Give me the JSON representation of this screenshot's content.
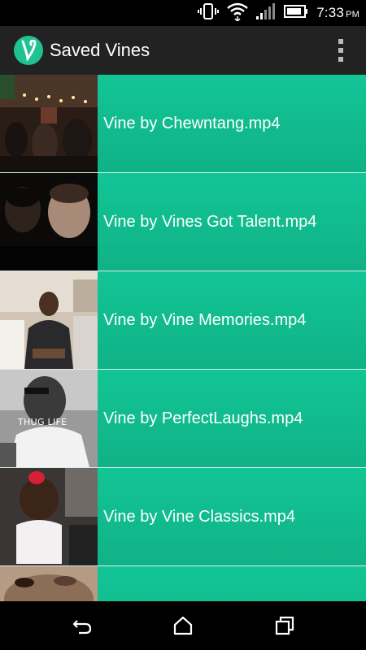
{
  "status_bar": {
    "time": "7:33",
    "ampm": "PM"
  },
  "action_bar": {
    "title": "Saved Vines"
  },
  "vines": [
    {
      "label": "Vine by Chewntang.mp4"
    },
    {
      "label": "Vine by Vines Got Talent.mp4"
    },
    {
      "label": "Vine by Vine Memories.mp4"
    },
    {
      "label": "Vine by PerfectLaughs.mp4",
      "thumb_text": "THUG LIFE"
    },
    {
      "label": "Vine by Vine Classics.mp4"
    },
    {
      "label": ""
    }
  ],
  "colors": {
    "accent": "#12c596",
    "action_bar": "#222222"
  }
}
